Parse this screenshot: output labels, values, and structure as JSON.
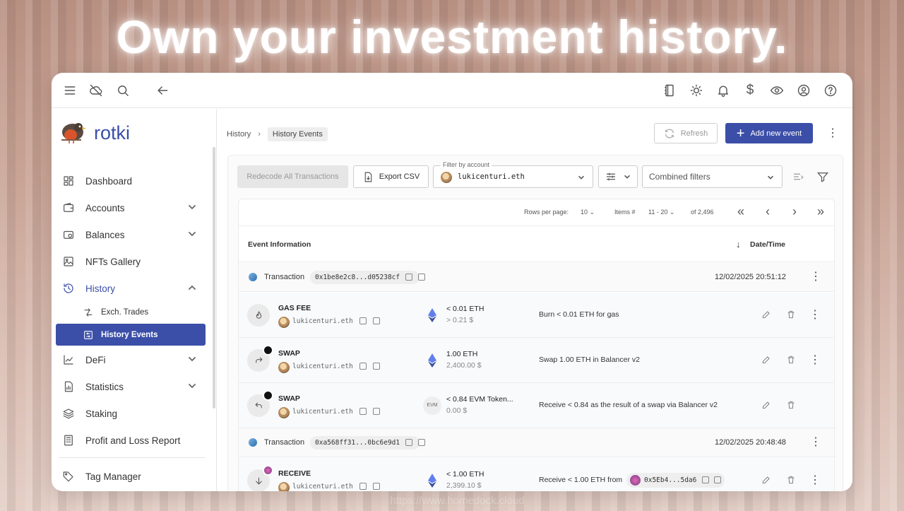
{
  "headline": "Own your investment history.",
  "watermark": "https://www.homedock.cloud",
  "brand": {
    "name": "rotki",
    "accent": "#3b4ea8"
  },
  "topbar": {
    "left_icons": [
      "menu-icon",
      "cloud-off-icon",
      "search-icon",
      "back-arrow-icon"
    ],
    "right_icons": [
      "notes-icon",
      "theme-icon",
      "bell-icon",
      "currency-icon",
      "eye-icon",
      "account-icon",
      "help-icon"
    ],
    "currency_symbol": "$"
  },
  "sidebar": {
    "items": [
      {
        "label": "Dashboard",
        "icon": "dashboard-icon",
        "expandable": false
      },
      {
        "label": "Accounts",
        "icon": "wallet-icon",
        "expandable": true
      },
      {
        "label": "Balances",
        "icon": "balances-icon",
        "expandable": true
      },
      {
        "label": "NFTs Gallery",
        "icon": "image-icon",
        "expandable": false
      },
      {
        "label": "History",
        "icon": "history-icon",
        "expandable": true,
        "expanded": true
      },
      {
        "label": "DeFi",
        "icon": "chart-line-icon",
        "expandable": true
      },
      {
        "label": "Statistics",
        "icon": "statistics-icon",
        "expandable": true
      },
      {
        "label": "Staking",
        "icon": "layers-icon",
        "expandable": false
      },
      {
        "label": "Profit and Loss Report",
        "icon": "report-icon",
        "expandable": false
      },
      {
        "label": "Tag Manager",
        "icon": "tag-icon",
        "expandable": false
      }
    ],
    "history_sub": [
      {
        "label": "Exch. Trades",
        "icon": "trades-icon",
        "active": false
      },
      {
        "label": "History Events",
        "icon": "events-icon",
        "active": true
      }
    ]
  },
  "breadcrumb": {
    "parent": "History",
    "current": "History Events"
  },
  "actions": {
    "refresh": "Refresh",
    "add": "Add new event"
  },
  "toolbar": {
    "redecode": "Redecode All Transactions",
    "export": "Export CSV",
    "account_filter_label": "Filter by account",
    "account_filter_value": "lukicenturi.eth",
    "combined_filters": "Combined filters"
  },
  "pagination": {
    "rows_label": "Rows per page:",
    "rows_value": "10",
    "items_label": "Items #",
    "items_value": "11 - 20",
    "of_total": "of 2,496"
  },
  "table": {
    "col_event": "Event Information",
    "col_date": "Date/Time"
  },
  "tx1": {
    "label": "Transaction",
    "hash": "0x1be8e2c8...d05238cf",
    "date": "12/02/2025 20:51:12"
  },
  "tx2": {
    "label": "Transaction",
    "hash": "0xa568ff31...0bc6e9d1",
    "date": "12/02/2025 20:48:48"
  },
  "events": [
    {
      "type": "GAS FEE",
      "account": "lukicenturi.eth",
      "amount": "< 0.01 ETH",
      "value": "> 0.21 $",
      "desc": "Burn < 0.01 ETH for gas",
      "icon": "flame-icon"
    },
    {
      "type": "SWAP",
      "account": "lukicenturi.eth",
      "amount": "1.00 ETH",
      "value": "2,400.00 $",
      "desc": "Swap 1.00 ETH in Balancer v2",
      "icon": "swap-out-icon"
    },
    {
      "type": "SWAP",
      "account": "lukicenturi.eth",
      "amount": "< 0.84 EVM Token...",
      "value": "0.00 $",
      "desc": "Receive < 0.84 as the result of a swap via Balancer v2",
      "icon": "swap-in-icon",
      "asset_badge": "EVM"
    },
    {
      "type": "RECEIVE",
      "account": "lukicenturi.eth",
      "amount": "< 1.00 ETH",
      "value": "2,399.10 $",
      "desc": "Receive < 1.00 ETH from",
      "counterparty": "0x5Eb4...5da6",
      "icon": "receive-icon"
    }
  ]
}
